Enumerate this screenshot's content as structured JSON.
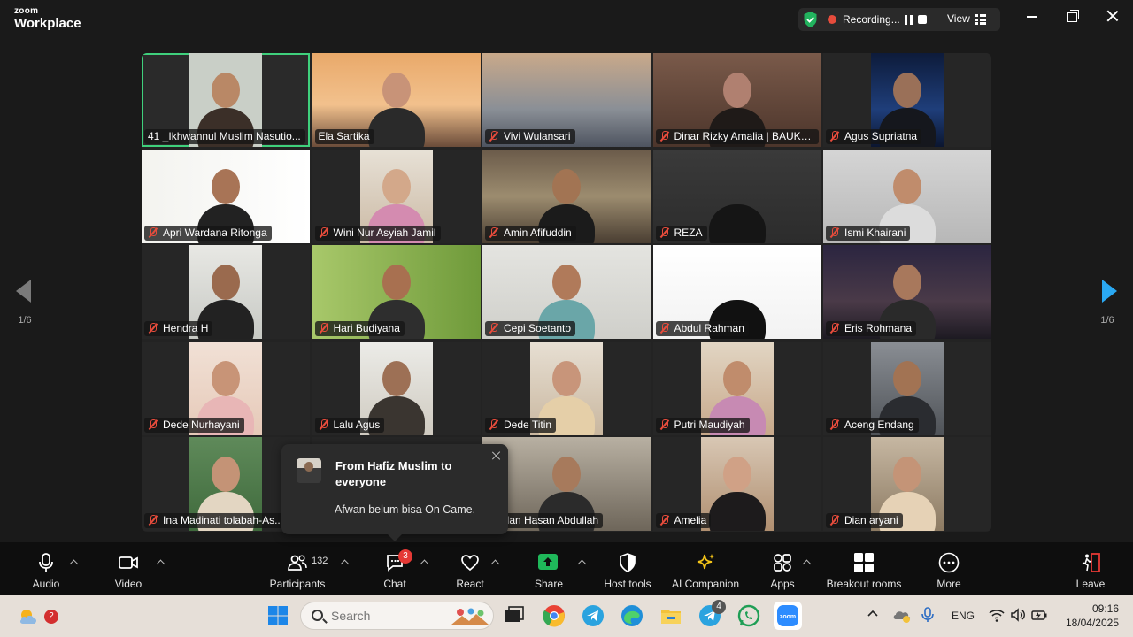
{
  "app": {
    "logo_line1": "zoom",
    "logo_line2": "Workplace"
  },
  "status_bar": {
    "recording_label": "Recording...",
    "view_label": "View"
  },
  "gallery": {
    "page_indicator_left": "1/6",
    "page_indicator_right": "1/6",
    "participants": [
      {
        "name": "41 _Ikhwannul Muslim Nasutio...",
        "muted": false,
        "active": true,
        "bg": "#2a2a2a",
        "video": {
          "bg": "#c9cfc7",
          "person": "#3b2f28",
          "face": "#b98866"
        }
      },
      {
        "name": "Ela Sartika",
        "muted": false,
        "active": false,
        "bg": "#2a2a2a",
        "video": {
          "bg": "linear-gradient(#e9a96a,#f2c18d 55%,#6b4c3a)",
          "person": "#2a2a2a",
          "face": "#c89378"
        }
      },
      {
        "name": "Vivi Wulansari",
        "muted": true,
        "active": false,
        "bg": "#2a2a2a",
        "video": {
          "bg": "linear-gradient(#c9a98a,#8a8f96 60%,#4e5460)",
          "person": "",
          "face": ""
        }
      },
      {
        "name": "Dinar Rizky Amalia | BAUK S...",
        "muted": true,
        "active": false,
        "bg": "#2a2a2a",
        "video": {
          "bg": "linear-gradient(#7a5a4a,#4c352b)",
          "person": "#1f1a18",
          "face": "#b08070"
        }
      },
      {
        "name": "Agus Supriatna",
        "muted": true,
        "active": false,
        "bg": "#262626",
        "video": {
          "bg": "linear-gradient(#0d1b3a,#1f3e7a 60%,#0b1630)",
          "person": "#15171d",
          "face": "#9a7058"
        }
      },
      {
        "name": "Apri Wardana Ritonga",
        "muted": true,
        "active": false,
        "bg": "#2a2a2a",
        "video": {
          "bg": "linear-gradient(90deg,#f3f3ef,#ffffff)",
          "person": "#222",
          "face": "#a87456"
        }
      },
      {
        "name": "Wini Nur Asyiah Jamil",
        "muted": true,
        "active": false,
        "bg": "#262626",
        "video": {
          "bg": "linear-gradient(#e7e1d6,#cbb9a4)",
          "person": "#d48bb0",
          "face": "#d3a88a"
        }
      },
      {
        "name": "Amin Afifuddin",
        "muted": true,
        "active": false,
        "bg": "#2a2a2a",
        "video": {
          "bg": "linear-gradient(#6b5b4a,#9c8c6f 50%,#4a3e32)",
          "person": "#1b1b1b",
          "face": "#a27453"
        }
      },
      {
        "name": "REZA",
        "muted": true,
        "active": false,
        "bg": "#2a2a2a",
        "video": {
          "bg": "linear-gradient(#3a3a3a,#2c2c2c)",
          "person": "#151515",
          "face": ""
        }
      },
      {
        "name": "Ismi Khairani",
        "muted": true,
        "active": false,
        "bg": "#2a2a2a",
        "video": {
          "bg": "linear-gradient(#d5d5d5,#b7b7b7)",
          "person": "#dcdcdc",
          "face": "#c08c6c"
        }
      },
      {
        "name": "Hendra H",
        "muted": true,
        "active": false,
        "bg": "#262626",
        "video": {
          "bg": "linear-gradient(#e8e8e4,#c7c9c4)",
          "person": "#222",
          "face": "#9a6a4e"
        }
      },
      {
        "name": "Hari Budiyana",
        "muted": true,
        "active": false,
        "bg": "#2a2a2a",
        "video": {
          "bg": "linear-gradient(90deg,#a8c86a,#6f9a3a)",
          "person": "#2e2e2e",
          "face": "#a87050"
        }
      },
      {
        "name": "Cepi Soetanto",
        "muted": true,
        "active": false,
        "bg": "#2a2a2a",
        "video": {
          "bg": "linear-gradient(#e4e4e0,#cfcfca)",
          "person": "#6aa6a8",
          "face": "#b07a5a"
        }
      },
      {
        "name": "Abdul Rahman",
        "muted": true,
        "active": false,
        "bg": "#2a2a2a",
        "video": {
          "bg": "linear-gradient(#ffffff,#f2f2f2)",
          "person": "#111",
          "face": ""
        }
      },
      {
        "name": "Eris Rohmana",
        "muted": true,
        "active": false,
        "bg": "#2a2a2a",
        "video": {
          "bg": "linear-gradient(#2b2540,#4a3a48 60%,#1d1a22)",
          "person": "#2a2a2a",
          "face": "#a8785c"
        }
      },
      {
        "name": "Dede Nurhayani",
        "muted": true,
        "active": false,
        "bg": "#262626",
        "video": {
          "bg": "linear-gradient(#f1e1d6,#e6c9b8)",
          "person": "#e8b6b6",
          "face": "#c89477"
        }
      },
      {
        "name": "Lalu Agus",
        "muted": true,
        "active": false,
        "bg": "#262626",
        "video": {
          "bg": "linear-gradient(#ecece8,#cfcac0)",
          "person": "#3a3530",
          "face": "#9d7055"
        }
      },
      {
        "name": "Dede Titin",
        "muted": true,
        "active": false,
        "bg": "#262626",
        "video": {
          "bg": "linear-gradient(#e7dfd3,#c9b79f)",
          "person": "#e5cfa8",
          "face": "#c8957a"
        }
      },
      {
        "name": "Putri Maudiyah",
        "muted": true,
        "active": false,
        "bg": "#262626",
        "video": {
          "bg": "linear-gradient(#e2d6c4,#c7a88a)",
          "person": "#c78ab3",
          "face": "#c08c6c"
        }
      },
      {
        "name": "Aceng Endang",
        "muted": true,
        "active": false,
        "bg": "#262626",
        "video": {
          "bg": "linear-gradient(#8a8e94,#4f5358)",
          "person": "#2a2c30",
          "face": "#a27353"
        }
      },
      {
        "name": "Ina Madinati tolabah-As...",
        "muted": true,
        "active": false,
        "bg": "#262626",
        "video": {
          "bg": "linear-gradient(#5f8a5a,#3f6a3c)",
          "person": "#e3d6c2",
          "face": "#c49376"
        }
      },
      {
        "name": "",
        "muted": false,
        "active": false,
        "bg": "#262626",
        "video": {
          "bg": "",
          "person": "",
          "face": ""
        }
      },
      {
        "name": "Wildan Hasan Abdullah",
        "muted": false,
        "active": false,
        "bg": "#262626",
        "video": {
          "bg": "linear-gradient(#b8b0a2,#6e665a)",
          "person": "#2b2b2b",
          "face": "#a77a5c"
        }
      },
      {
        "name": "Amelia",
        "muted": true,
        "active": false,
        "bg": "#262626",
        "video": {
          "bg": "linear-gradient(#d8c7b4,#b08f70)",
          "person": "#1d1b1c",
          "face": "#d0a186"
        }
      },
      {
        "name": "Dian aryani",
        "muted": true,
        "active": false,
        "bg": "#262626",
        "video": {
          "bg": "linear-gradient(#c6b7a2,#8c7a62)",
          "person": "#e6d2b6",
          "face": "#c49477"
        }
      }
    ]
  },
  "chat_toast": {
    "title": "From Hafiz Muslim to everyone",
    "message": "Afwan belum bisa On Came."
  },
  "toolbar": {
    "audio": "Audio",
    "video": "Video",
    "participants": "Participants",
    "participants_count": "132",
    "chat": "Chat",
    "chat_badge": "3",
    "react": "React",
    "share": "Share",
    "host_tools": "Host tools",
    "ai_companion": "AI Companion",
    "apps": "Apps",
    "breakout_rooms": "Breakout rooms",
    "more": "More",
    "leave": "Leave"
  },
  "taskbar": {
    "weather_badge": "2",
    "search_placeholder": "Search",
    "telegram_badge": "4",
    "language": "ENG",
    "time": "09:16",
    "date": "18/04/2025"
  },
  "colors": {
    "accent_green": "#3fd07c",
    "share_green": "#1fb85a",
    "leave_red": "#e53935",
    "nav_blue": "#2aa8f2"
  }
}
